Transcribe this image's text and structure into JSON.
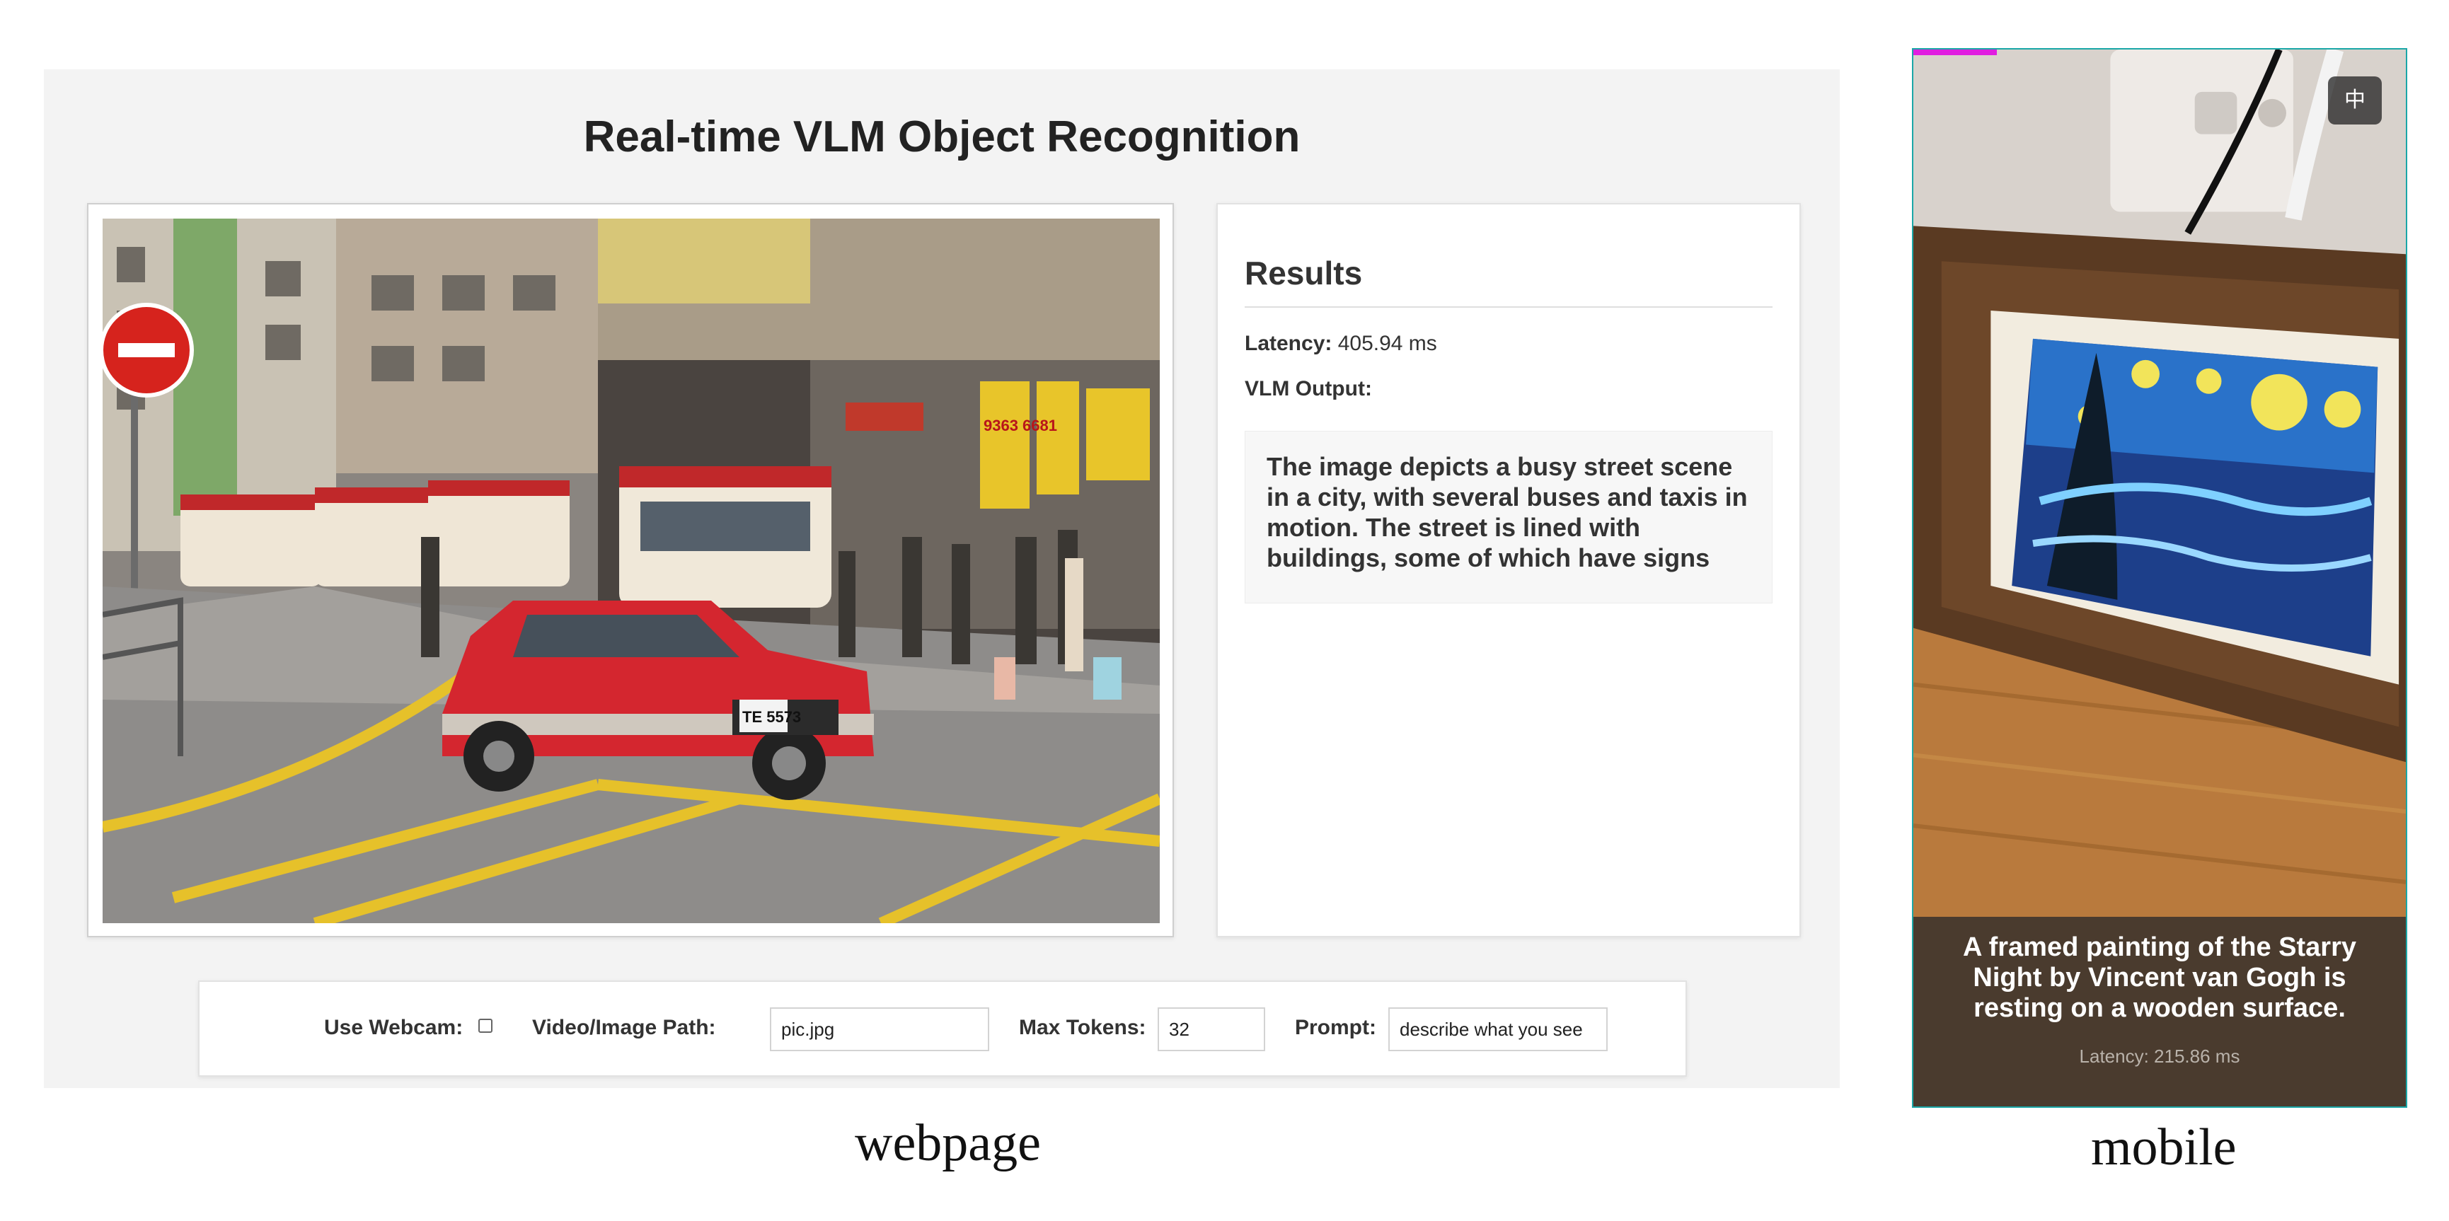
{
  "labels": {
    "webpage_caption": "webpage",
    "mobile_caption": "mobile"
  },
  "webpage": {
    "title": "Real-time VLM Object Recognition",
    "street_photo": {
      "icon": "street-scene-photo",
      "sign_text": "9363 6681",
      "plate_text": "TE 5573"
    },
    "results": {
      "title": "Results",
      "latency_label": "Latency:",
      "latency_value": "405.94 ms",
      "vlm_output_label": "VLM Output:",
      "vlm_output_text": "The image depicts a busy street scene in a city, with several buses and taxis in motion. The street is lined with buildings, some of which have signs"
    },
    "controls": {
      "use_webcam_label": "Use Webcam:",
      "use_webcam_checked": false,
      "path_label": "Video/Image Path:",
      "path_value": "pic.jpg",
      "max_tokens_label": "Max Tokens:",
      "max_tokens_value": "32",
      "prompt_label": "Prompt:",
      "prompt_value": "describe what you see"
    }
  },
  "mobile": {
    "lang_button": "中",
    "progress_fraction": 0.17,
    "progress_color": "#e01ee0",
    "scene_icon": "framed-starry-night-photo",
    "caption": "A framed painting of the Starry Night by Vincent van Gogh is resting on a wooden surface.",
    "latency": "Latency: 215.86 ms"
  }
}
